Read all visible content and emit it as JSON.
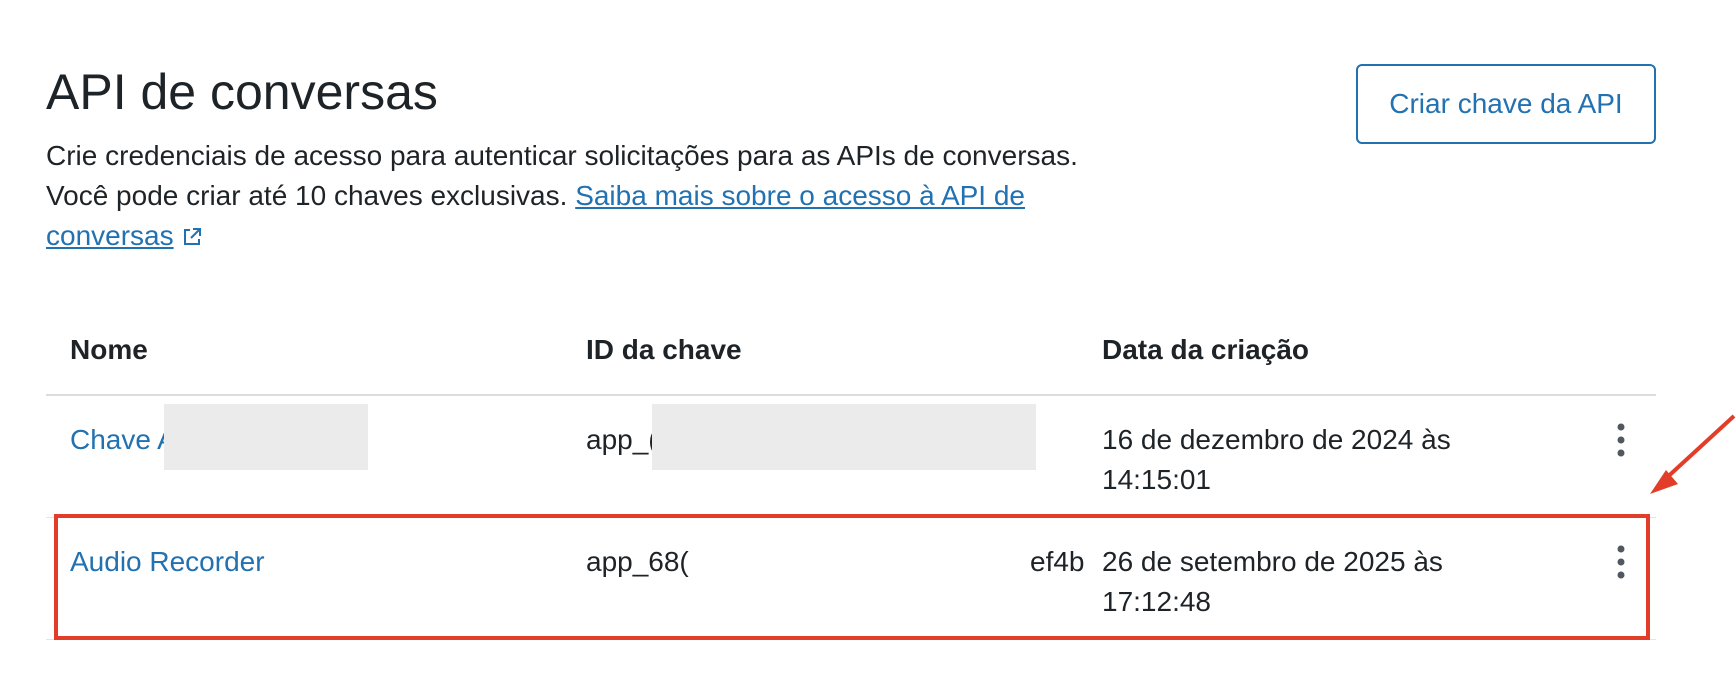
{
  "header": {
    "title": "API de conversas",
    "description_line1": "Crie credenciais de acesso para autenticar solicitações para as APIs de conversas.",
    "description_line2": "Você pode criar até 10 chaves exclusivas.",
    "learn_more_link": "Saiba mais sobre o acesso à API de conversas",
    "external_icon": "external-link-icon"
  },
  "actions": {
    "create_key_label": "Criar chave da API"
  },
  "table": {
    "columns": [
      "Nome",
      "ID da chave",
      "Data da criação"
    ],
    "rows": [
      {
        "name": "Chave A",
        "key_id": "app_(",
        "key_id_tail": "",
        "created": "16 de dezembro de 2024 às 14:15:01",
        "menu_icon": "more-vertical-icon"
      },
      {
        "name": "Audio Recorder",
        "key_id": "app_68(",
        "key_id_tail": "ef4b",
        "created": "26 de setembro de 2025 às 17:12:48",
        "menu_icon": "more-vertical-icon"
      }
    ]
  },
  "annotation": {
    "highlight_color": "#e23d28",
    "arrow_icon": "arrow-annotation-icon"
  },
  "colors": {
    "link": "#2271b1",
    "text": "#1d2327",
    "border": "#dcdcde",
    "redaction": "#ebebeb"
  }
}
